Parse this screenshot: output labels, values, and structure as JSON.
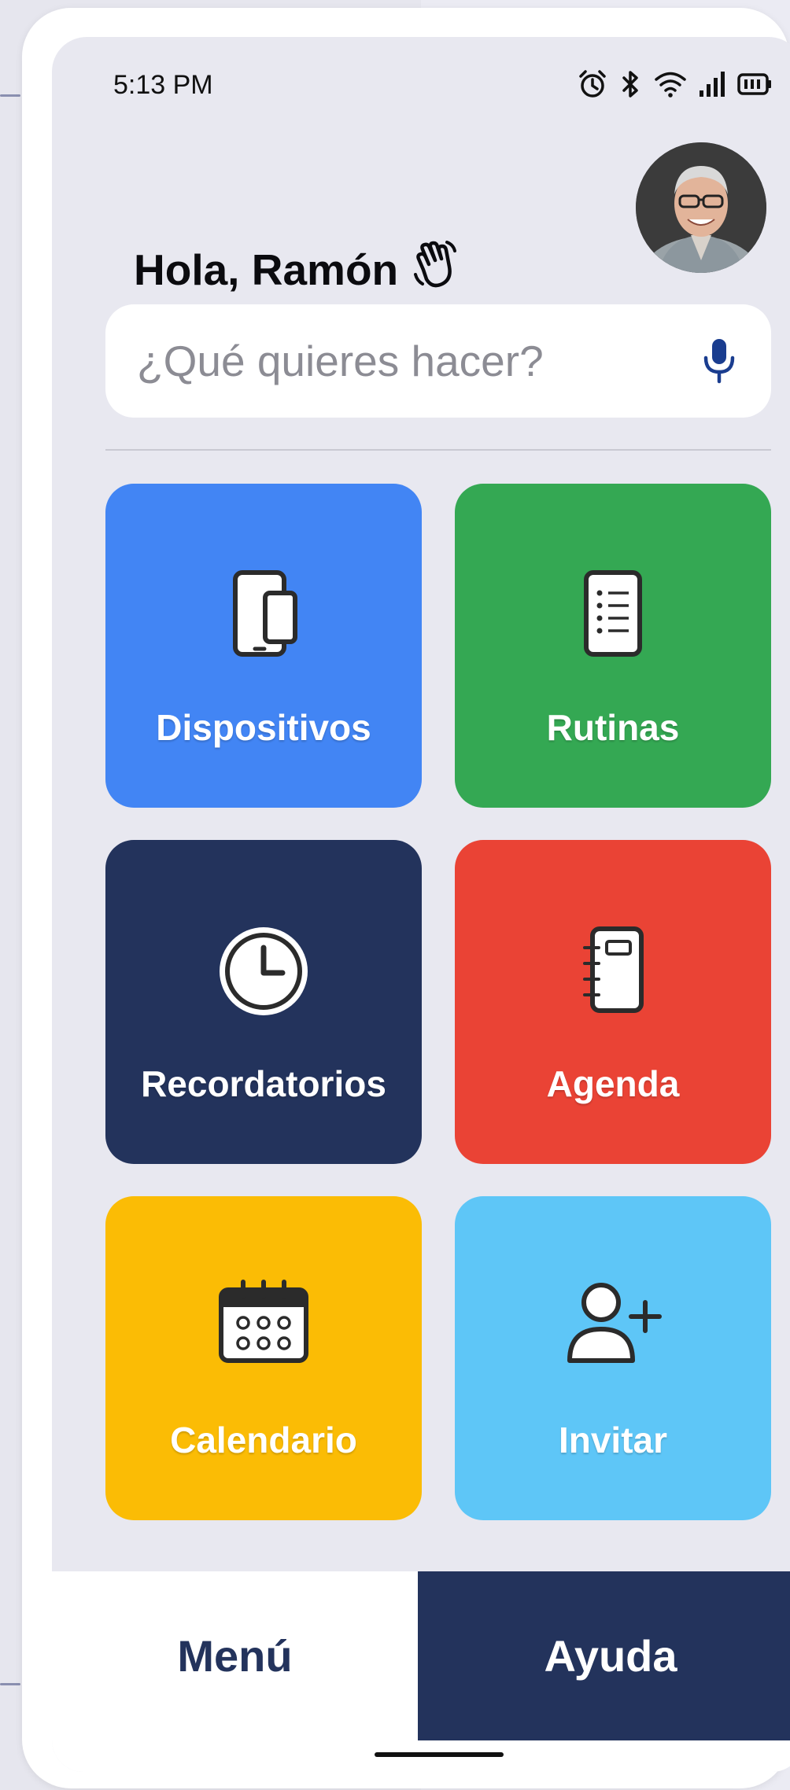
{
  "status_bar": {
    "time": "5:13 PM",
    "icons": [
      "alarm-icon",
      "bluetooth-icon",
      "wifi-icon",
      "signal-icon",
      "battery-icon"
    ]
  },
  "header": {
    "greeting": "Hola, Ramón",
    "wave_icon": "waving-hand-icon",
    "avatar": "user-avatar"
  },
  "search": {
    "placeholder": "¿Qué quieres hacer?",
    "value": "",
    "mic_icon": "microphone-icon"
  },
  "tiles": [
    {
      "label": "Dispositivos",
      "icon": "devices-icon",
      "color": "#4285f4"
    },
    {
      "label": "Rutinas",
      "icon": "list-icon",
      "color": "#34a853"
    },
    {
      "label": "Recordatorios",
      "icon": "clock-icon",
      "color": "#23335c"
    },
    {
      "label": "Agenda",
      "icon": "notebook-icon",
      "color": "#ea4335"
    },
    {
      "label": "Calendario",
      "icon": "calendar-icon",
      "color": "#fbbc05"
    },
    {
      "label": "Invitar",
      "icon": "add-user-icon",
      "color": "#5ec6f7"
    }
  ],
  "bottom_bar": {
    "menu_label": "Menú",
    "help_label": "Ayuda"
  },
  "colors": {
    "screen_bg": "#e8e8f0",
    "navy": "#23335c",
    "accent_blue": "#1a3d8f"
  }
}
